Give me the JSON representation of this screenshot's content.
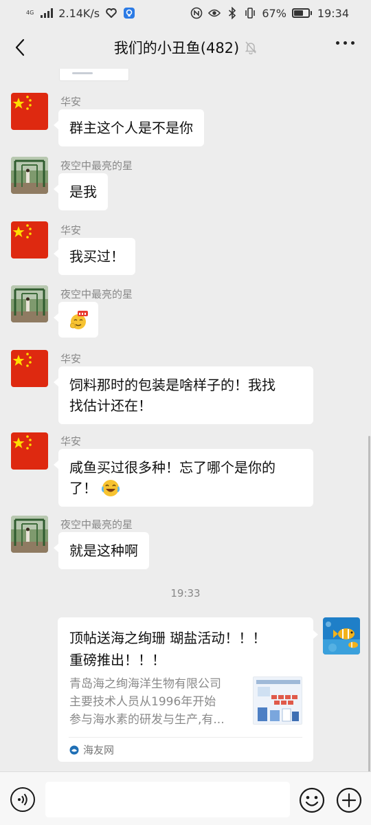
{
  "status_bar": {
    "network_tag": "4G",
    "speed": "2.14K/s",
    "battery": "67%",
    "battery_level": 0.67,
    "time": "19:34"
  },
  "header": {
    "title": "我们的小丑鱼(482)",
    "back_icon": "chevron-left-icon",
    "mute_icon": "bell-off-icon",
    "more_icon": "more-dots-icon"
  },
  "messages": [
    {
      "sender": "华安",
      "avatar": "china-flag-avatar",
      "text": "群主这个人是不是你"
    },
    {
      "sender": "夜空中最亮的星",
      "avatar": "garden-photo-avatar",
      "text": "是我"
    },
    {
      "sender": "华安",
      "avatar": "china-flag-avatar",
      "text": "我买过！"
    },
    {
      "sender": "夜空中最亮的星",
      "avatar": "garden-photo-avatar",
      "sticker": "666-emoji"
    },
    {
      "sender": "华安",
      "avatar": "china-flag-avatar",
      "lines": [
        "饲料那时的包装是啥样子的！我找",
        "找估计还在！"
      ]
    },
    {
      "sender": "华安",
      "avatar": "china-flag-avatar",
      "lines": [
        "咸鱼买过很多种！忘了哪个是你的",
        "了！"
      ],
      "trailing_emoji": "laughing-tears-emoji"
    },
    {
      "sender": "夜空中最亮的星",
      "avatar": "garden-photo-avatar",
      "text": "就是这种啊"
    }
  ],
  "time_separator": "19:33",
  "link_card": {
    "title_lines": [
      "顶帖送海之绚珊 瑚盐活动！！！",
      "重磅推出！！！"
    ],
    "description_lines": [
      "青岛海之绚海洋生物有限公司",
      "主要技术人员从1996年开始",
      "参与海水素的研发与生产,有..."
    ],
    "source": "海友网",
    "source_icon": "haiyou-logo-icon",
    "thumbnail": "product-thumbnail"
  },
  "self_avatar": "clownfish-avatar",
  "input_bar": {
    "voice_icon": "voice-icon",
    "emoji_icon": "smiley-icon",
    "plus_icon": "plus-icon",
    "input_value": ""
  }
}
